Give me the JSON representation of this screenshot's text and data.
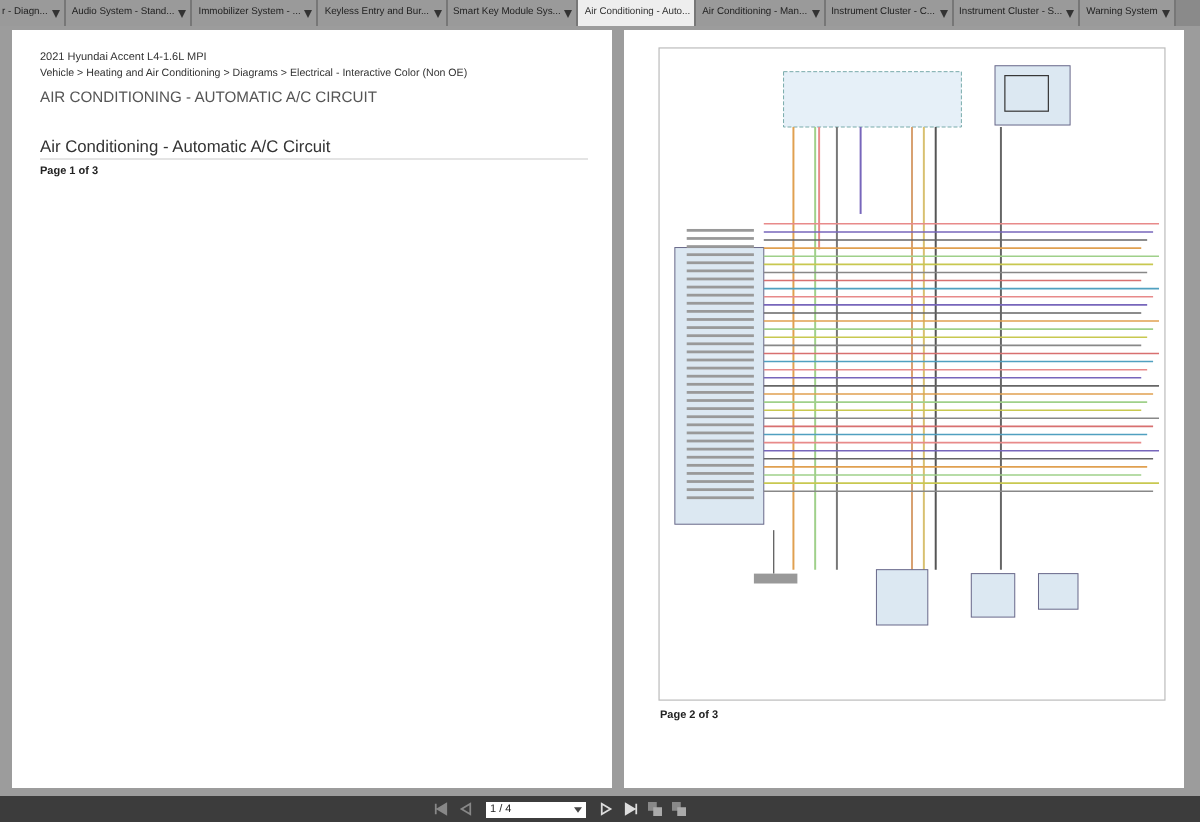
{
  "tabs": [
    {
      "label": "r - Diagn...",
      "selected": false
    },
    {
      "label": "Audio System - Stand...",
      "selected": false
    },
    {
      "label": "Immobilizer System - ...",
      "selected": false
    },
    {
      "label": "Keyless Entry and Bur...",
      "selected": false
    },
    {
      "label": "Smart Key Module Sys...",
      "selected": false
    },
    {
      "label": "Air Conditioning - Auto...",
      "selected": true
    },
    {
      "label": "Air Conditioning - Man...",
      "selected": false
    },
    {
      "label": "Instrument Cluster - C...",
      "selected": false
    },
    {
      "label": "Instrument Cluster - S...",
      "selected": false
    },
    {
      "label": "Warning System",
      "selected": false
    }
  ],
  "left_page": {
    "vehicle": "2021 Hyundai Accent L4-1.6L MPI",
    "breadcrumb": "Vehicle > Heating and Air Conditioning > Diagrams > Electrical - Interactive Color (Non OE)",
    "heading": "AIR CONDITIONING - AUTOMATIC A/C CIRCUIT",
    "title": "Air Conditioning - Automatic A/C Circuit",
    "page_label": "Page 1 of 3"
  },
  "right_page": {
    "page_label": "Page 2 of 3"
  },
  "toolbar": {
    "page_field": "1 / 4"
  }
}
